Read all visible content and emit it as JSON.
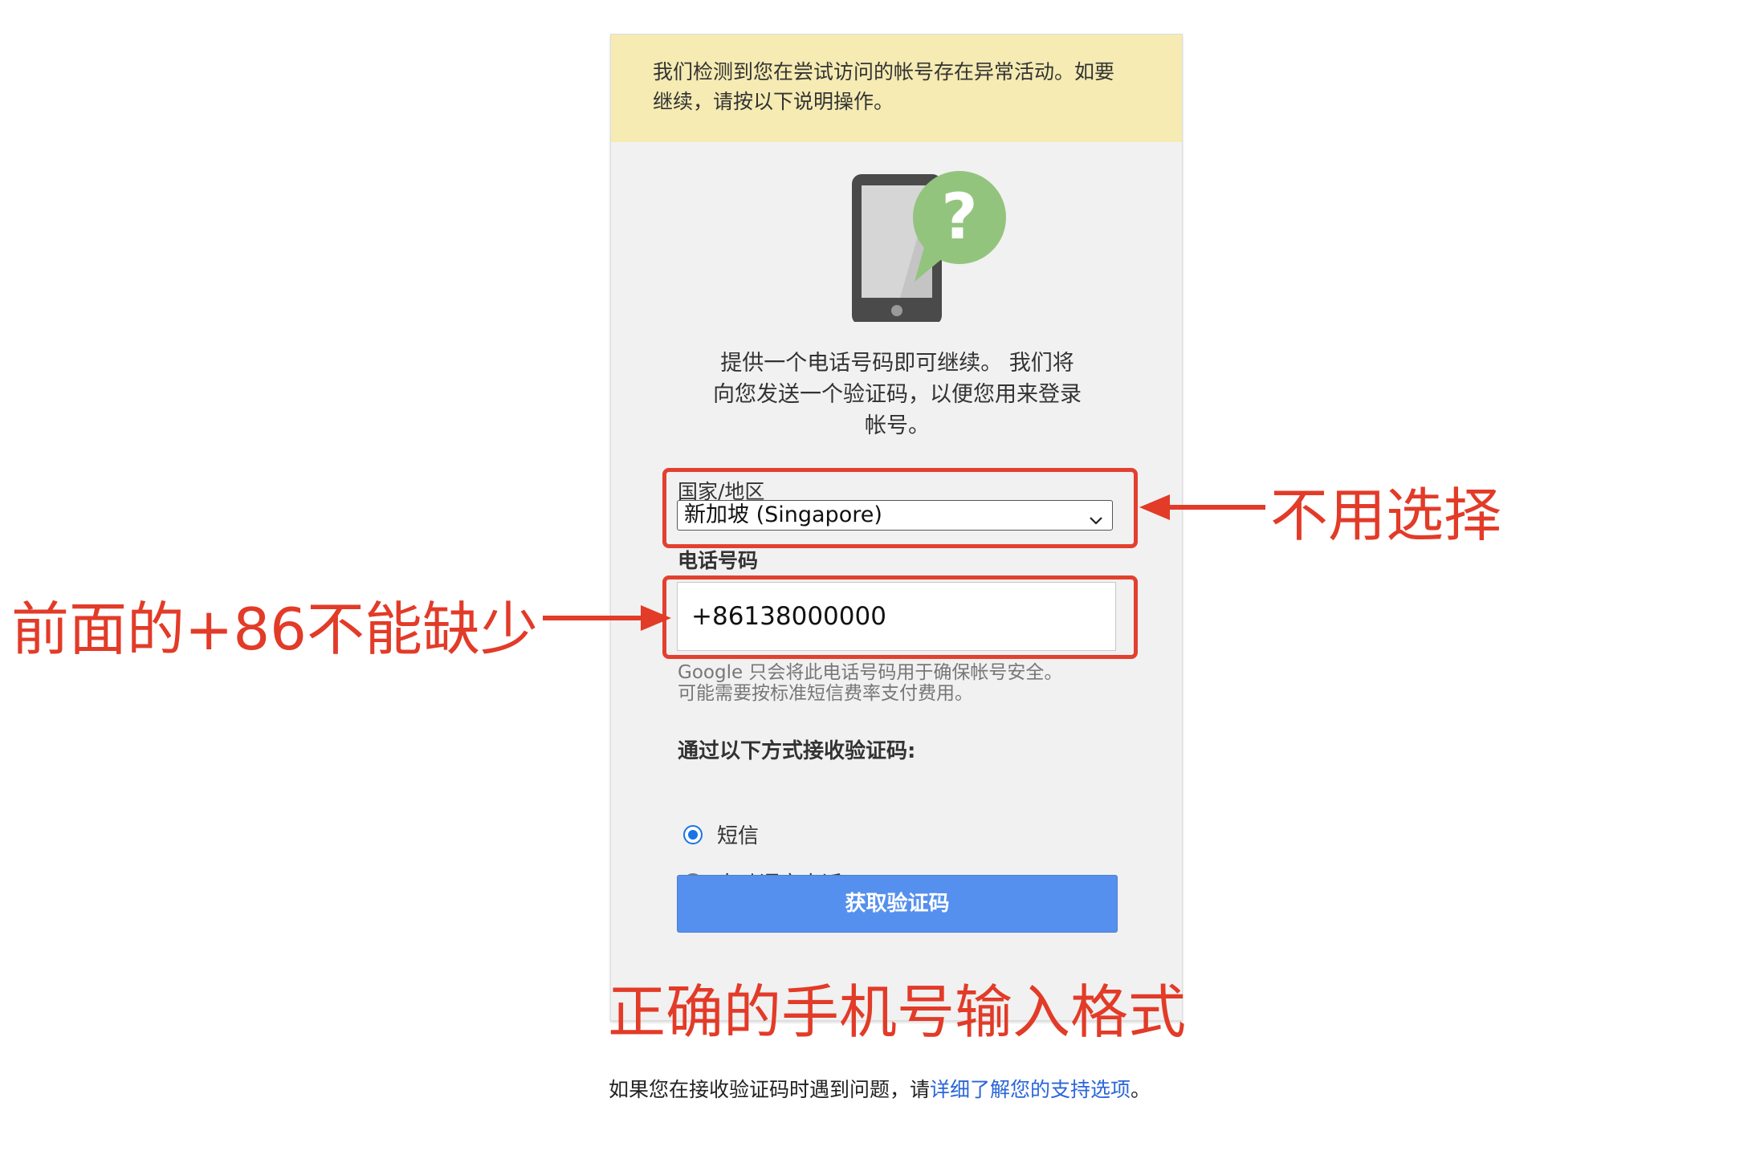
{
  "banner": {
    "text_line1": "我们检测到您在尝试访问的帐号存在异常活动。如要",
    "text_line2": "继续，请按以下说明操作。"
  },
  "intro": {
    "line1": "提供一个电话号码即可继续。 我们将",
    "line2": "向您发送一个验证码，以便您用来登录",
    "line3": "帐号。"
  },
  "country": {
    "label": "国家/地区",
    "selected": "新加坡 (Singapore)"
  },
  "phone": {
    "label": "电话号码",
    "value": "+86138000000",
    "hint_line1": "Google 只会将此电话号码用于确保帐号安全。",
    "hint_line2": "可能需要按标准短信费率支付费用。"
  },
  "method": {
    "label": "通过以下方式接收验证码:",
    "options": [
      {
        "label": "短信",
        "selected": true
      },
      {
        "label": "自动语音电话",
        "selected": false
      }
    ]
  },
  "button": {
    "label": "获取验证码"
  },
  "footer": {
    "prefix": "如果您在接收验证码时遇到问题，请",
    "link": "详细了解您的支持选项",
    "suffix": "。"
  },
  "annotations": {
    "no_select": "不用选择",
    "keep_prefix": "前面的+86不能缺少",
    "correct_format": "正确的手机号输入格式"
  },
  "colors": {
    "banner_bg": "#f5ebb3",
    "button_bg": "#5690ee",
    "annotation_red": "#e23b28",
    "link_blue": "#2a66d9",
    "help_bubble_green": "#93c47d"
  },
  "icons": [
    "phone-question-icon",
    "chevron-down-icon",
    "radio-checked-icon",
    "radio-unchecked-icon",
    "arrow-left-icon",
    "arrow-right-icon"
  ]
}
